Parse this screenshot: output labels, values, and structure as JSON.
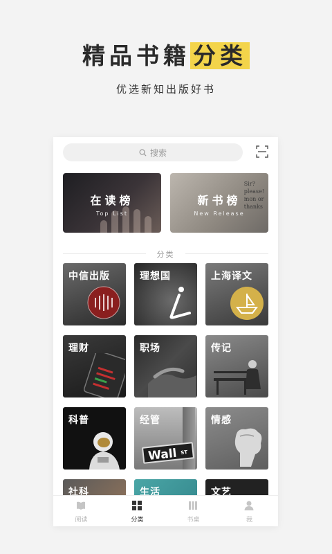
{
  "hero": {
    "title_main": "精品书籍",
    "title_highlight": "分类",
    "subtitle": "优选新知出版好书"
  },
  "search": {
    "placeholder": "搜索",
    "icon": "search-icon"
  },
  "scan": {
    "icon": "scan-icon"
  },
  "banners": [
    {
      "title": "在读榜",
      "subtitle": "Top List"
    },
    {
      "title": "新书榜",
      "subtitle": "New Release",
      "paper_text": [
        "Sir?",
        "please!",
        "mon or",
        "thanks"
      ]
    }
  ],
  "section": {
    "label": "分类"
  },
  "categories": [
    {
      "label": "中信出版"
    },
    {
      "label": "理想国"
    },
    {
      "label": "上海译文"
    },
    {
      "label": "理财"
    },
    {
      "label": "职场"
    },
    {
      "label": "传记"
    },
    {
      "label": "科普"
    },
    {
      "label": "经管",
      "sign_text": "Wall",
      "sign_suffix": "ST"
    },
    {
      "label": "情感"
    },
    {
      "label": "社科"
    },
    {
      "label": "生活"
    },
    {
      "label": "文艺"
    }
  ],
  "tabs": [
    {
      "label": "阅读",
      "icon": "book-icon",
      "active": false
    },
    {
      "label": "分类",
      "icon": "grid-icon",
      "active": true
    },
    {
      "label": "书桌",
      "icon": "bookshelf-icon",
      "active": false
    },
    {
      "label": "我",
      "icon": "person-icon",
      "active": false
    }
  ],
  "colors": {
    "highlight": "#f3d44a",
    "accent_gold": "#d4b14a",
    "citic_red": "#8a1f1f"
  }
}
